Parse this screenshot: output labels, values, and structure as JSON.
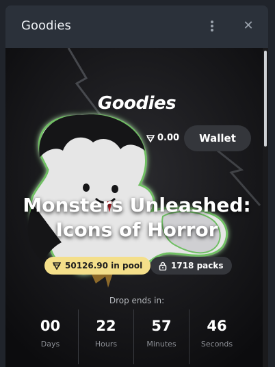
{
  "window": {
    "title": "Goodies"
  },
  "brand": {
    "logo_text": "Goodies"
  },
  "wallet": {
    "balance": "0.00",
    "button_label": "Wallet"
  },
  "drop": {
    "title_line1": "Monsters Unleashed:",
    "title_line2": "Icons of Horror",
    "pool_text": "50126.90 in pool",
    "packs_text": "1718 packs"
  },
  "countdown": {
    "label": "Drop ends in:",
    "units": [
      {
        "value": "00",
        "label": "Days"
      },
      {
        "value": "22",
        "label": "Hours"
      },
      {
        "value": "57",
        "label": "Minutes"
      },
      {
        "value": "46",
        "label": "Seconds"
      }
    ]
  },
  "colors": {
    "pool_pill": "#f4df8a",
    "background": "#121214",
    "glow": "#5fa85a"
  }
}
